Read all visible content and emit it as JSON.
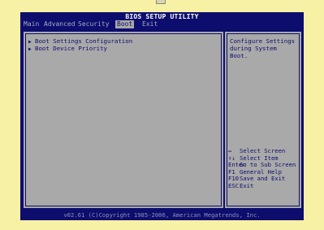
{
  "title": "BIOS SETUP UTILITY",
  "menu": [
    {
      "label": "Main",
      "active": false
    },
    {
      "label": "Advanced",
      "active": false
    },
    {
      "label": "Security",
      "active": false
    },
    {
      "label": "Boot",
      "active": true
    },
    {
      "label": "Exit",
      "active": false
    }
  ],
  "entries": [
    {
      "label": "Boot Settings Configuration",
      "marker": "▶"
    },
    {
      "label": "Boot Device Priority",
      "marker": "▶"
    }
  ],
  "help": {
    "description": "Configure Settings during System Boot.",
    "keys": [
      {
        "key": "↔",
        "action": "Select Screen"
      },
      {
        "key": "↑↓",
        "action": "Select Item"
      },
      {
        "key": "Enter",
        "action": "Go to Sub Screen"
      },
      {
        "key": "F1",
        "action": "General Help"
      },
      {
        "key": "F10",
        "action": "Save and Exit"
      },
      {
        "key": "ESC",
        "action": "Exit"
      }
    ]
  },
  "footer": "v02.61 (C)Copyright 1985-2006, American Megatrends, Inc.",
  "colors": {
    "background": "#f7f1a6",
    "bios_blue": "#0d0d6d",
    "panel_gray": "#a9a9a9"
  }
}
